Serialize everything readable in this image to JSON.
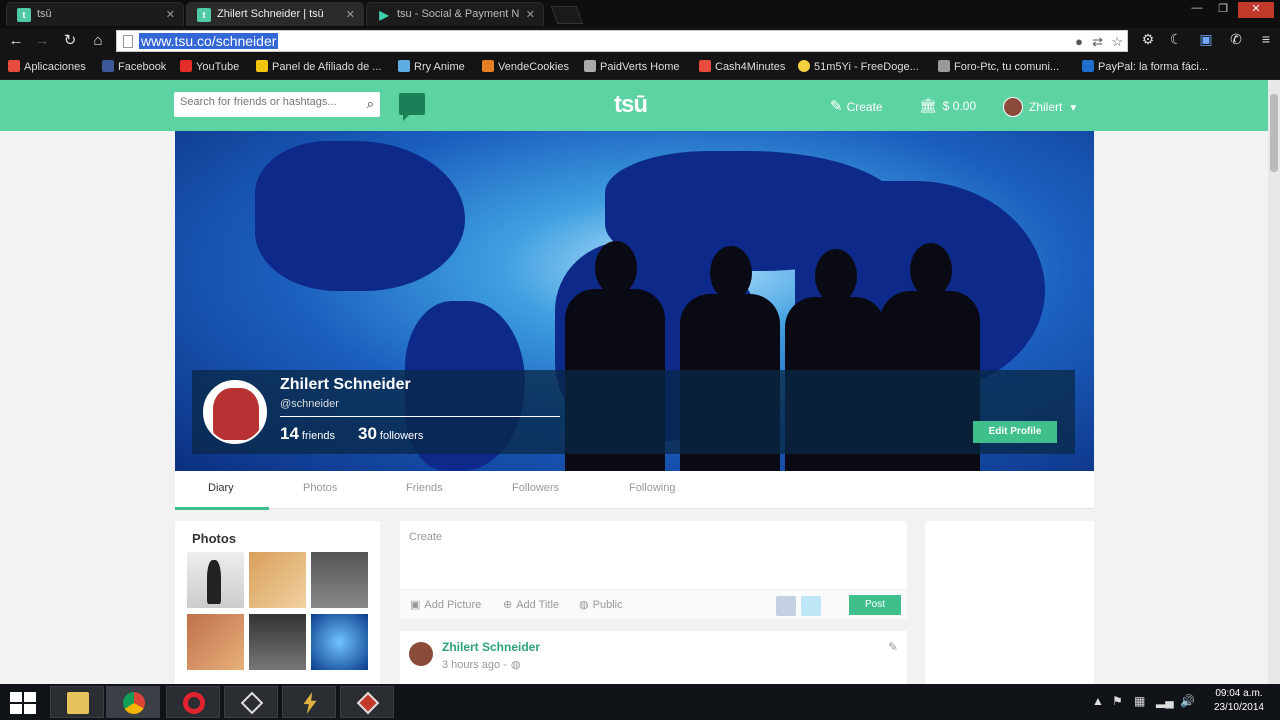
{
  "browser": {
    "tabs": [
      {
        "title": "tsū",
        "favicon": "tsu"
      },
      {
        "title": "Zhilert Schneider | tsū",
        "favicon": "tsu"
      },
      {
        "title": "tsu - Social & Payment N",
        "favicon": "play"
      }
    ],
    "url": "www.tsu.co/schneider",
    "bookmarks": [
      {
        "label": "Aplicaciones",
        "color": "#e74c3c"
      },
      {
        "label": "Facebook",
        "color": "#3b5998"
      },
      {
        "label": "YouTube",
        "color": "#e52d27"
      },
      {
        "label": "Panel de Afiliado de ...",
        "color": "#f1c40f"
      },
      {
        "label": "Rry Anime",
        "color": "#5dade2"
      },
      {
        "label": "VendeCookies",
        "color": "#e67e22"
      },
      {
        "label": "PaidVerts Home",
        "color": "#aaaaaa"
      },
      {
        "label": "Cash4Minutes",
        "color": "#e74c3c"
      },
      {
        "label": "51m5Yi - FreeDoge...",
        "color": "#f4d03f"
      },
      {
        "label": "Foro-Ptc, tu comuni...",
        "color": "#999999"
      },
      {
        "label": "PayPal: la forma fáci...",
        "color": "#1f6fd1"
      }
    ]
  },
  "header": {
    "search_placeholder": "Search for friends or hashtags...",
    "logo": "tsū",
    "create_label": "Create",
    "balance": "$ 0.00",
    "username": "Zhilert"
  },
  "profile": {
    "name": "Zhilert Schneider",
    "handle": "@schneider",
    "friends_count": "14",
    "friends_label": "friends",
    "followers_count": "30",
    "followers_label": "followers",
    "edit_label": "Edit Profile"
  },
  "profile_tabs": [
    "Diary",
    "Photos",
    "Friends",
    "Followers",
    "Following"
  ],
  "photos": {
    "title": "Photos"
  },
  "composer": {
    "placeholder": "Create",
    "add_picture": "Add Picture",
    "add_title": "Add Title",
    "visibility": "Public",
    "post_label": "Post"
  },
  "post": {
    "author": "Zhilert Schneider",
    "time": "3 hours ago -"
  },
  "taskbar": {
    "time": "09:04 a.m.",
    "date": "23/10/2014"
  }
}
